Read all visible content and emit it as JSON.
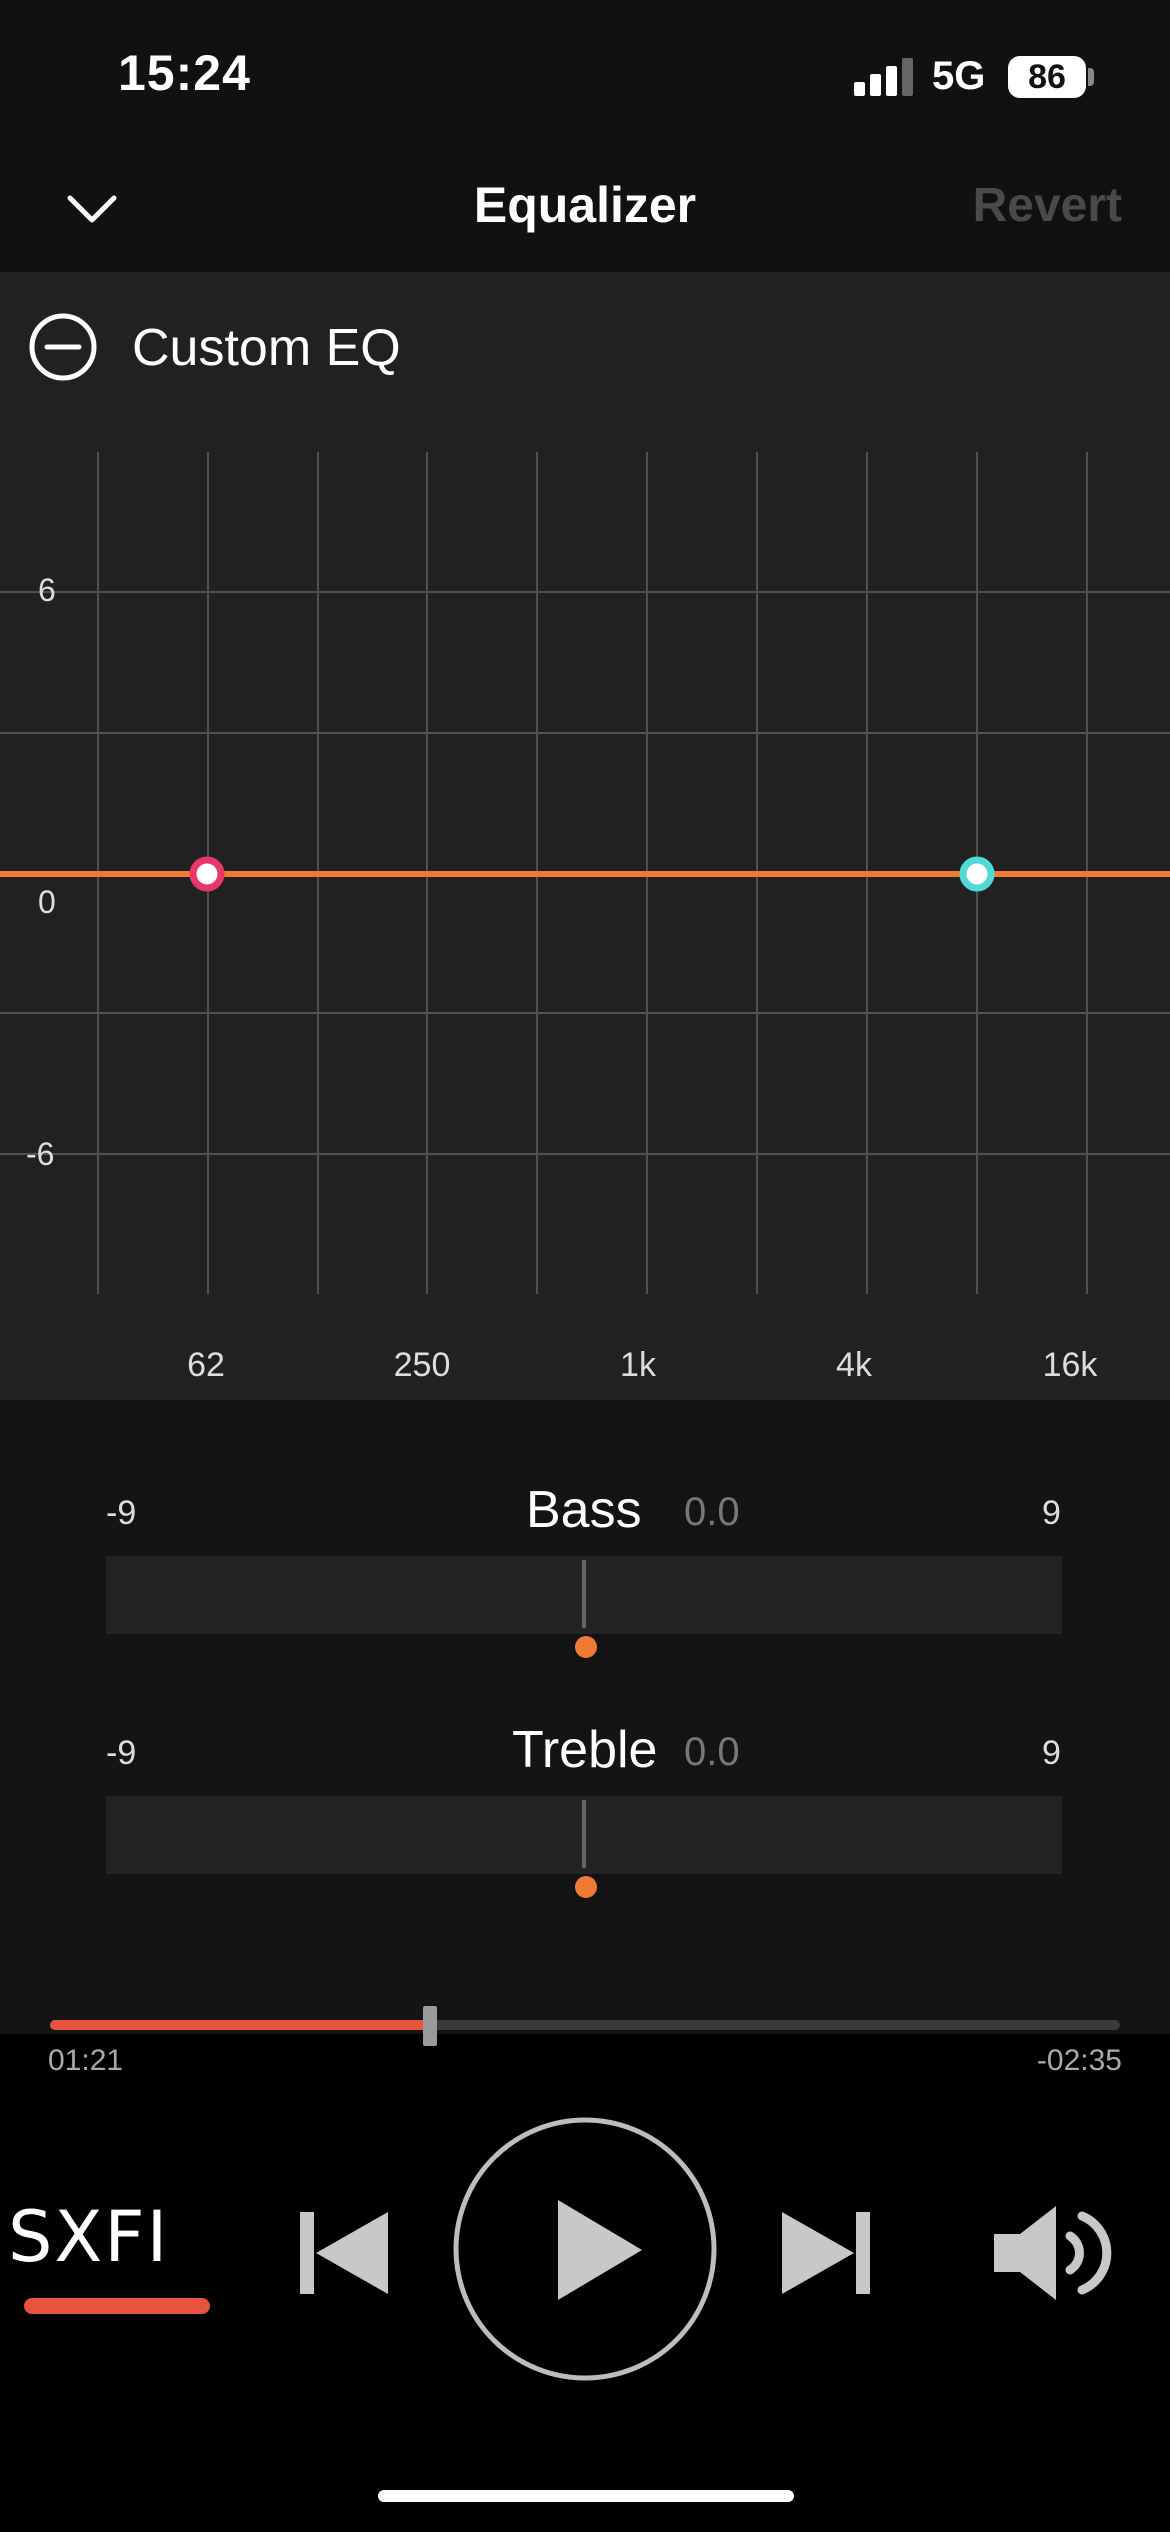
{
  "status_bar": {
    "time": "15:24",
    "network": "5G",
    "battery": "86"
  },
  "header": {
    "title": "Equalizer",
    "revert_label": "Revert"
  },
  "eq": {
    "preset_name": "Custom EQ",
    "y_labels": [
      "6",
      "0",
      "-6"
    ],
    "x_labels": [
      "62",
      "250",
      "1k",
      "4k",
      "16k"
    ],
    "curve_color": "#ee7a35",
    "bass_node_color": "#e8356a",
    "treble_node_color": "#4fd9d9",
    "bass_gain_db": 0,
    "treble_gain_db": 0
  },
  "sliders": [
    {
      "name": "Bass",
      "value": "0.0",
      "min": "-9",
      "max": "9"
    },
    {
      "name": "Treble",
      "value": "0.0",
      "min": "-9",
      "max": "9"
    }
  ],
  "playback": {
    "elapsed": "01:21",
    "remaining": "-02:35",
    "progress_fraction": 0.355,
    "accent_color": "#e8533f"
  },
  "controls": {
    "sxfi_label": "SXFI"
  }
}
